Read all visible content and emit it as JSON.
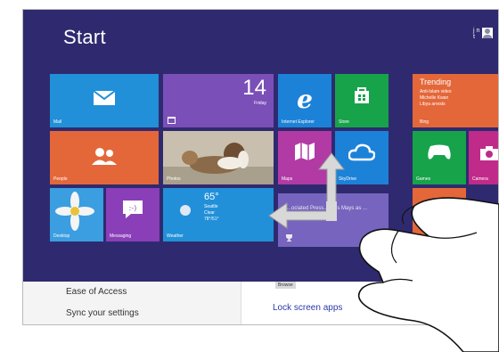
{
  "start": {
    "title": "Start",
    "user_name": "j nt"
  },
  "colors": {
    "background": "#2f2a6f",
    "mail": "#2190d8",
    "calendar": "#7b4fb8",
    "ie": "#1c82d8",
    "store": "#16a34a",
    "people": "#e4673a",
    "maps": "#b23aa5",
    "skydrive": "#1c82d8",
    "desktop": "#2190d8",
    "messaging": "#8a3fb8",
    "weather": "#2190d8",
    "news": "#9b84d6",
    "bing": "#e4673a",
    "games": "#16a34a",
    "camera": "#c02b8a"
  },
  "tiles": {
    "mail": {
      "label": "Mail",
      "icon": "mail-icon"
    },
    "calendar": {
      "date": "14",
      "day": "Friday",
      "icon": "calendar-icon"
    },
    "ie": {
      "label": "Internet Explorer",
      "icon": "internet-explorer-icon"
    },
    "store": {
      "label": "Store",
      "icon": "store-icon"
    },
    "bing": {
      "title": "Trending",
      "lines": [
        "Anti-Islam video",
        "Michelle Kwan",
        "Libya arrests"
      ],
      "label": "Bing"
    },
    "people": {
      "label": "People",
      "icon": "people-icon"
    },
    "photos": {
      "label": "Photos",
      "icon": "dog-photo-icon"
    },
    "maps": {
      "label": "Maps",
      "icon": "maps-icon"
    },
    "skydrive": {
      "label": "SkyDrive",
      "icon": "cloud-icon"
    },
    "games": {
      "label": "Games",
      "icon": "gamepad-icon"
    },
    "camera": {
      "label": "Camera",
      "icon": "camera-icon"
    },
    "desktop": {
      "label": "Desktop",
      "icon": "flower-icon"
    },
    "messaging": {
      "label": "Messaging",
      "icon": "message-bubble-icon"
    },
    "weather": {
      "label": "Weather",
      "temp": "65°",
      "city": "Seattle",
      "condition": "Clear",
      "range": "78°/51°",
      "icon": "moon-icon"
    },
    "news": {
      "text": "...ociated Press... ...es Mays as ...",
      "icon": "trophy-icon"
    }
  },
  "settings": {
    "items": [
      "Ease of Access",
      "Sync your settings"
    ]
  },
  "lockscreen": {
    "browse": "Browse",
    "title": "Lock screen apps"
  },
  "gesture": {
    "icon": "four-way-arrow-icon",
    "hand_icon": "hand-icon"
  }
}
